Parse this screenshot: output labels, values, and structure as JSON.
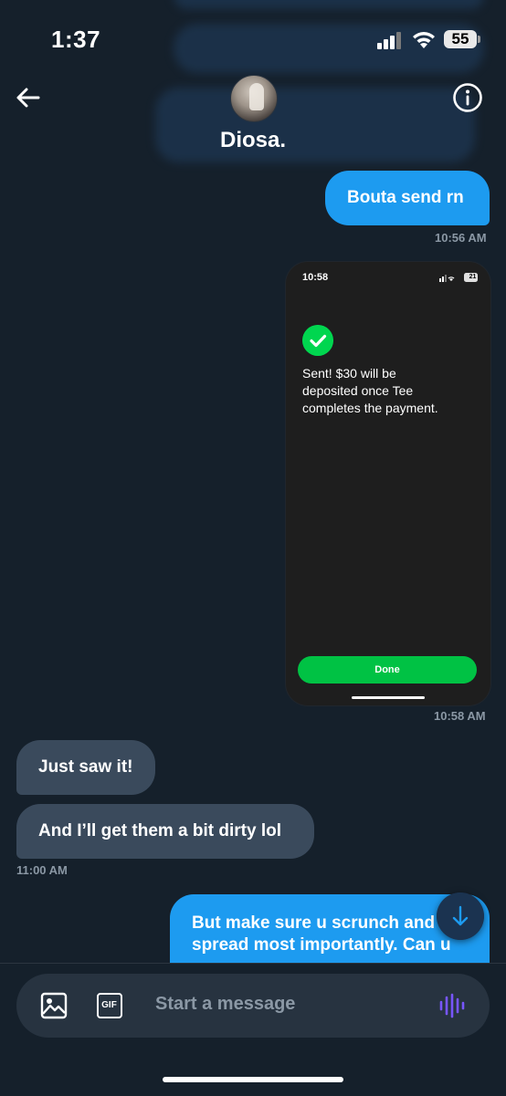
{
  "status_bar": {
    "time": "1:37",
    "battery": "55"
  },
  "header": {
    "name": "Diosa."
  },
  "messages": [
    {
      "text": "Bouta send rn",
      "time": "10:56 AM"
    },
    {
      "attachment": {
        "time": "10:58",
        "battery": "21",
        "line1": "Sent! $30 will be",
        "line2": "deposited once Tee",
        "line3": "completes the payment.",
        "button": "Done"
      },
      "time": "10:58 AM"
    },
    {
      "text": "Just saw it!"
    },
    {
      "text": "And I’ll get them a bit dirty lol",
      "time": "11:00 AM"
    },
    {
      "line1": "But make sure u scrunch and",
      "line2": "spread most importantly. Can u"
    }
  ],
  "composer": {
    "placeholder": "Start a message",
    "gif_label": "GIF"
  },
  "colors": {
    "background": "#15202b",
    "sent_bubble": "#1d9bf0",
    "received_bubble": "#3a4a5c",
    "muted_text": "#8b98a5",
    "cashapp_green": "#00d64f",
    "voice_accent": "#7856ff"
  },
  "icons": {
    "back": "arrow-left-icon",
    "info": "info-icon",
    "image": "image-icon",
    "gif": "gif-icon",
    "voice": "voice-wave-icon",
    "scroll_down": "arrow-down-icon"
  }
}
